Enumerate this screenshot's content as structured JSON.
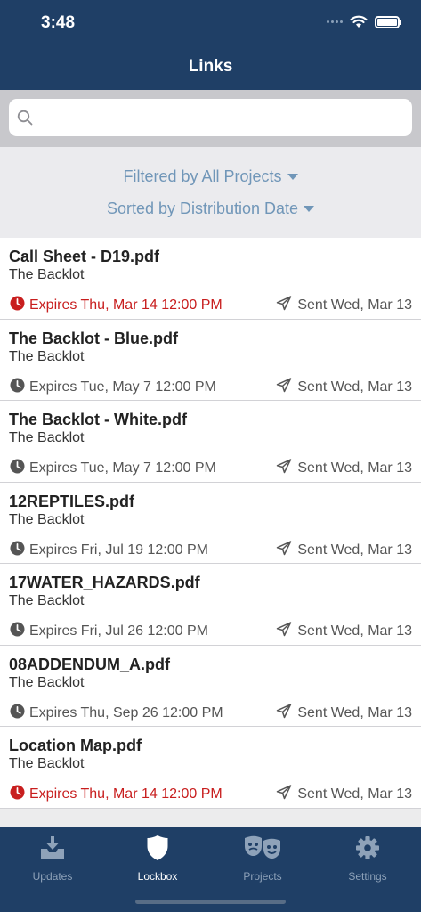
{
  "status_bar": {
    "time": "3:48"
  },
  "header": {
    "title": "Links"
  },
  "search": {
    "placeholder": ""
  },
  "filters": {
    "filtered_by": "Filtered by All Projects",
    "sorted_by": "Sorted by Distribution Date"
  },
  "colors": {
    "nav": "#1f3f66",
    "accent": "#7096b8",
    "urgent": "#c81e1e"
  },
  "links": [
    {
      "title": "Call Sheet - D19.pdf",
      "project": "The Backlot",
      "expires": "Expires Thu, Mar 14 12:00 PM",
      "urgent": true,
      "sent": "Sent Wed, Mar 13"
    },
    {
      "title": "The Backlot - Blue.pdf",
      "project": "The Backlot",
      "expires": "Expires Tue, May 7 12:00 PM",
      "urgent": false,
      "sent": "Sent Wed, Mar 13"
    },
    {
      "title": "The Backlot - White.pdf",
      "project": "The Backlot",
      "expires": "Expires Tue, May 7 12:00 PM",
      "urgent": false,
      "sent": "Sent Wed, Mar 13"
    },
    {
      "title": "12REPTILES.pdf",
      "project": "The Backlot",
      "expires": "Expires Fri, Jul 19 12:00 PM",
      "urgent": false,
      "sent": "Sent Wed, Mar 13"
    },
    {
      "title": "17WATER_HAZARDS.pdf",
      "project": "The Backlot",
      "expires": "Expires Fri, Jul 26 12:00 PM",
      "urgent": false,
      "sent": "Sent Wed, Mar 13"
    },
    {
      "title": "08ADDENDUM_A.pdf",
      "project": "The Backlot",
      "expires": "Expires Thu, Sep 26 12:00 PM",
      "urgent": false,
      "sent": "Sent Wed, Mar 13"
    },
    {
      "title": "Location Map.pdf",
      "project": "The Backlot",
      "expires": "Expires Thu, Mar 14 12:00 PM",
      "urgent": true,
      "sent": "Sent Wed, Mar 13"
    }
  ],
  "tabs": [
    {
      "label": "Updates",
      "icon": "inbox-download-icon",
      "active": false
    },
    {
      "label": "Lockbox",
      "icon": "shield-icon",
      "active": true
    },
    {
      "label": "Projects",
      "icon": "theater-masks-icon",
      "active": false
    },
    {
      "label": "Settings",
      "icon": "gear-icon",
      "active": false
    }
  ]
}
